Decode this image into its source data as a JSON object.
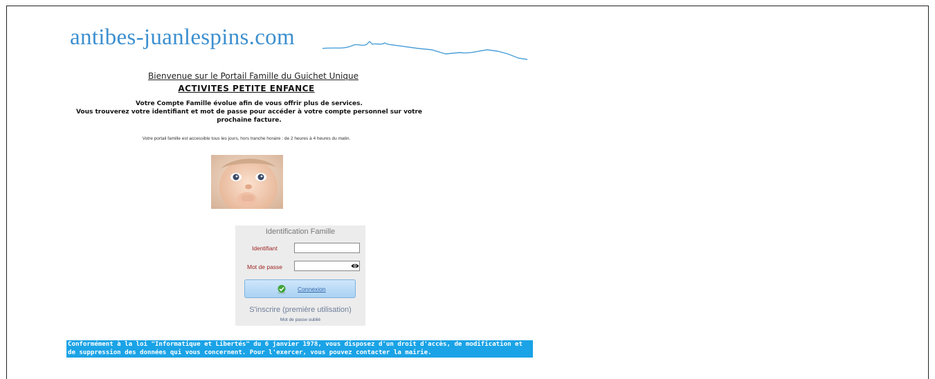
{
  "header": {
    "site_name": "antibes-juanlespins.com"
  },
  "intro": {
    "welcome": "Bienvenue sur le Portail Famille du Guichet Unique",
    "heading": "ACTIVITES PETITE ENFANCE",
    "line1": "Votre Compte Famille évolue afin de vous offrir plus de services.",
    "line2": "Vous trouverez votre identifiant et mot de passe pour accéder à votre compte personnel sur votre prochaine facture.",
    "hours": "Votre portail famille est accessible tous les jours, hors tranche horaire : de 2 heures à 4 heures du matin."
  },
  "login": {
    "title": "Identification Famille",
    "username_label": "Identifiant",
    "username_value": "",
    "password_label": "Mot de passe",
    "password_value": "",
    "password_toggle_icon": "eye-icon",
    "connect_label": "Connexion",
    "connect_icon": "check-circle-icon",
    "register_link": "S'inscrire (première utilisation)",
    "forgot_link": "Mot de passe oublié"
  },
  "footer": {
    "legal": "Conformément à la loi \"Informatique et Libertés\" du 6 janvier 1978, vous disposez d'un droit d'accès, de modification et de suppression des données qui vous concernent. Pour l'exercer, vous pouvez contacter la mairie."
  },
  "colors": {
    "logo": "#3c8fcf",
    "legal_bg": "#1aa3e6",
    "field_label": "#9c1f1f"
  }
}
